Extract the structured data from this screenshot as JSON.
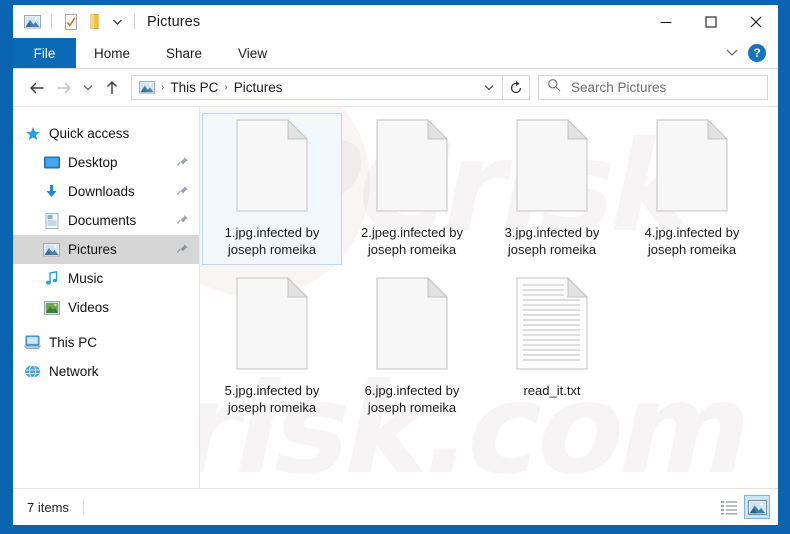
{
  "window": {
    "title": "Pictures",
    "quick_access_toolbar": [
      {
        "name": "pictures-folder-icon",
        "label": "Pictures"
      },
      {
        "name": "properties-icon",
        "label": "Properties"
      },
      {
        "name": "new-folder-icon",
        "label": "New folder"
      },
      {
        "name": "customize-chevron-icon",
        "label": "Customize Quick Access Toolbar"
      }
    ],
    "controls": {
      "minimize": "–",
      "maximize": "☐",
      "close": "✕"
    }
  },
  "ribbon": {
    "tabs": [
      {
        "label": "File",
        "active": true
      },
      {
        "label": "Home",
        "active": false
      },
      {
        "label": "Share",
        "active": false
      },
      {
        "label": "View",
        "active": false
      }
    ],
    "expand_chevron": "⌄",
    "help_label": "?"
  },
  "navigation": {
    "back": "←",
    "forward": "→",
    "recent": "⌄",
    "up": "↑",
    "refresh_label": "↻"
  },
  "address": {
    "breadcrumbs": [
      "This PC",
      "Pictures"
    ],
    "separator": "›",
    "dropdown": "⌄"
  },
  "search": {
    "placeholder": "Search Pictures"
  },
  "sidebar": {
    "items": [
      {
        "label": "Quick access",
        "icon": "star-icon",
        "level": 0,
        "pinned": false,
        "selected": false
      },
      {
        "label": "Desktop",
        "icon": "desktop-icon",
        "level": 1,
        "pinned": true,
        "selected": false
      },
      {
        "label": "Downloads",
        "icon": "downloads-icon",
        "level": 1,
        "pinned": true,
        "selected": false
      },
      {
        "label": "Documents",
        "icon": "documents-icon",
        "level": 1,
        "pinned": true,
        "selected": false
      },
      {
        "label": "Pictures",
        "icon": "pictures-icon",
        "level": 1,
        "pinned": true,
        "selected": true
      },
      {
        "label": "Music",
        "icon": "music-icon",
        "level": 1,
        "pinned": false,
        "selected": false
      },
      {
        "label": "Videos",
        "icon": "videos-icon",
        "level": 1,
        "pinned": false,
        "selected": false
      },
      {
        "label": "This PC",
        "icon": "this-pc-icon",
        "level": 0,
        "pinned": false,
        "selected": false
      },
      {
        "label": "Network",
        "icon": "network-icon",
        "level": 0,
        "pinned": false,
        "selected": false
      }
    ]
  },
  "files": [
    {
      "name": "1.jpg.infected by joseph romeika",
      "icon": "blank-file-icon",
      "selected": true
    },
    {
      "name": "2.jpeg.infected by joseph romeika",
      "icon": "blank-file-icon",
      "selected": false
    },
    {
      "name": "3.jpg.infected by joseph romeika",
      "icon": "blank-file-icon",
      "selected": false
    },
    {
      "name": "4.jpg.infected by joseph romeika",
      "icon": "blank-file-icon",
      "selected": false
    },
    {
      "name": "5.jpg.infected by joseph romeika",
      "icon": "blank-file-icon",
      "selected": false
    },
    {
      "name": "6.jpg.infected by joseph romeika",
      "icon": "blank-file-icon",
      "selected": false
    },
    {
      "name": "read_it.txt",
      "icon": "text-file-icon",
      "selected": false
    }
  ],
  "status": {
    "item_count": "7 items",
    "views": [
      {
        "name": "details-view-button",
        "active": false
      },
      {
        "name": "large-icons-view-button",
        "active": true
      }
    ]
  },
  "watermark": {
    "line1": "PCrisk",
    "line2": "risk.com"
  },
  "colors": {
    "desktop_blue": "#0a64b0",
    "file_tab_blue": "#0b6ab5",
    "selection_blue": "#f2f7fc",
    "selection_border": "#bcd8ef",
    "sidebar_selected": "#d6d6d6",
    "view_active": "#cde4f7"
  }
}
